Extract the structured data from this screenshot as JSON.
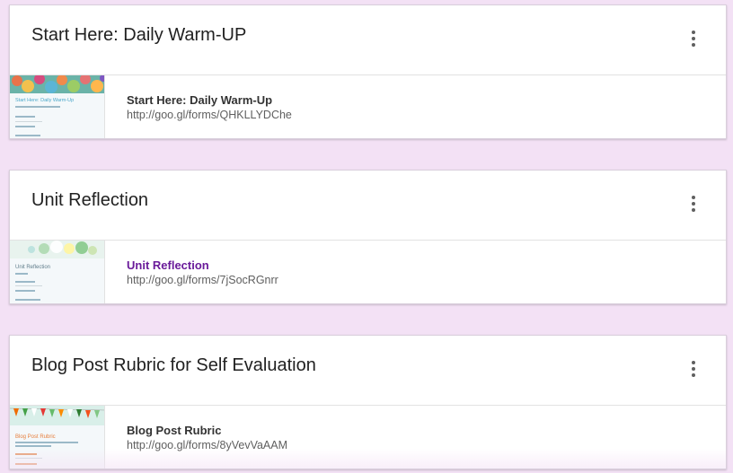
{
  "cards": [
    {
      "title": "Start Here: Daily Warm-UP",
      "form_name": "Start Here: Daily Warm-Up",
      "form_url": "http://goo.gl/forms/QHKLLYDChe",
      "thumb_title": "Start Here: Daily Warm-Up"
    },
    {
      "title": "Unit Reflection",
      "form_name": "Unit Reflection",
      "form_url": "http://goo.gl/forms/7jSocRGnrr",
      "thumb_title": "Unit Reflection"
    },
    {
      "title": "Blog Post Rubric for Self Evaluation",
      "form_name": "Blog Post Rubric",
      "form_url": "http://goo.gl/forms/8yVevVaAAM",
      "thumb_title": "Blog Post Rubric"
    }
  ],
  "colors": {
    "page_background": "#f3e1f5",
    "visited_link": "#6a1b9a"
  }
}
